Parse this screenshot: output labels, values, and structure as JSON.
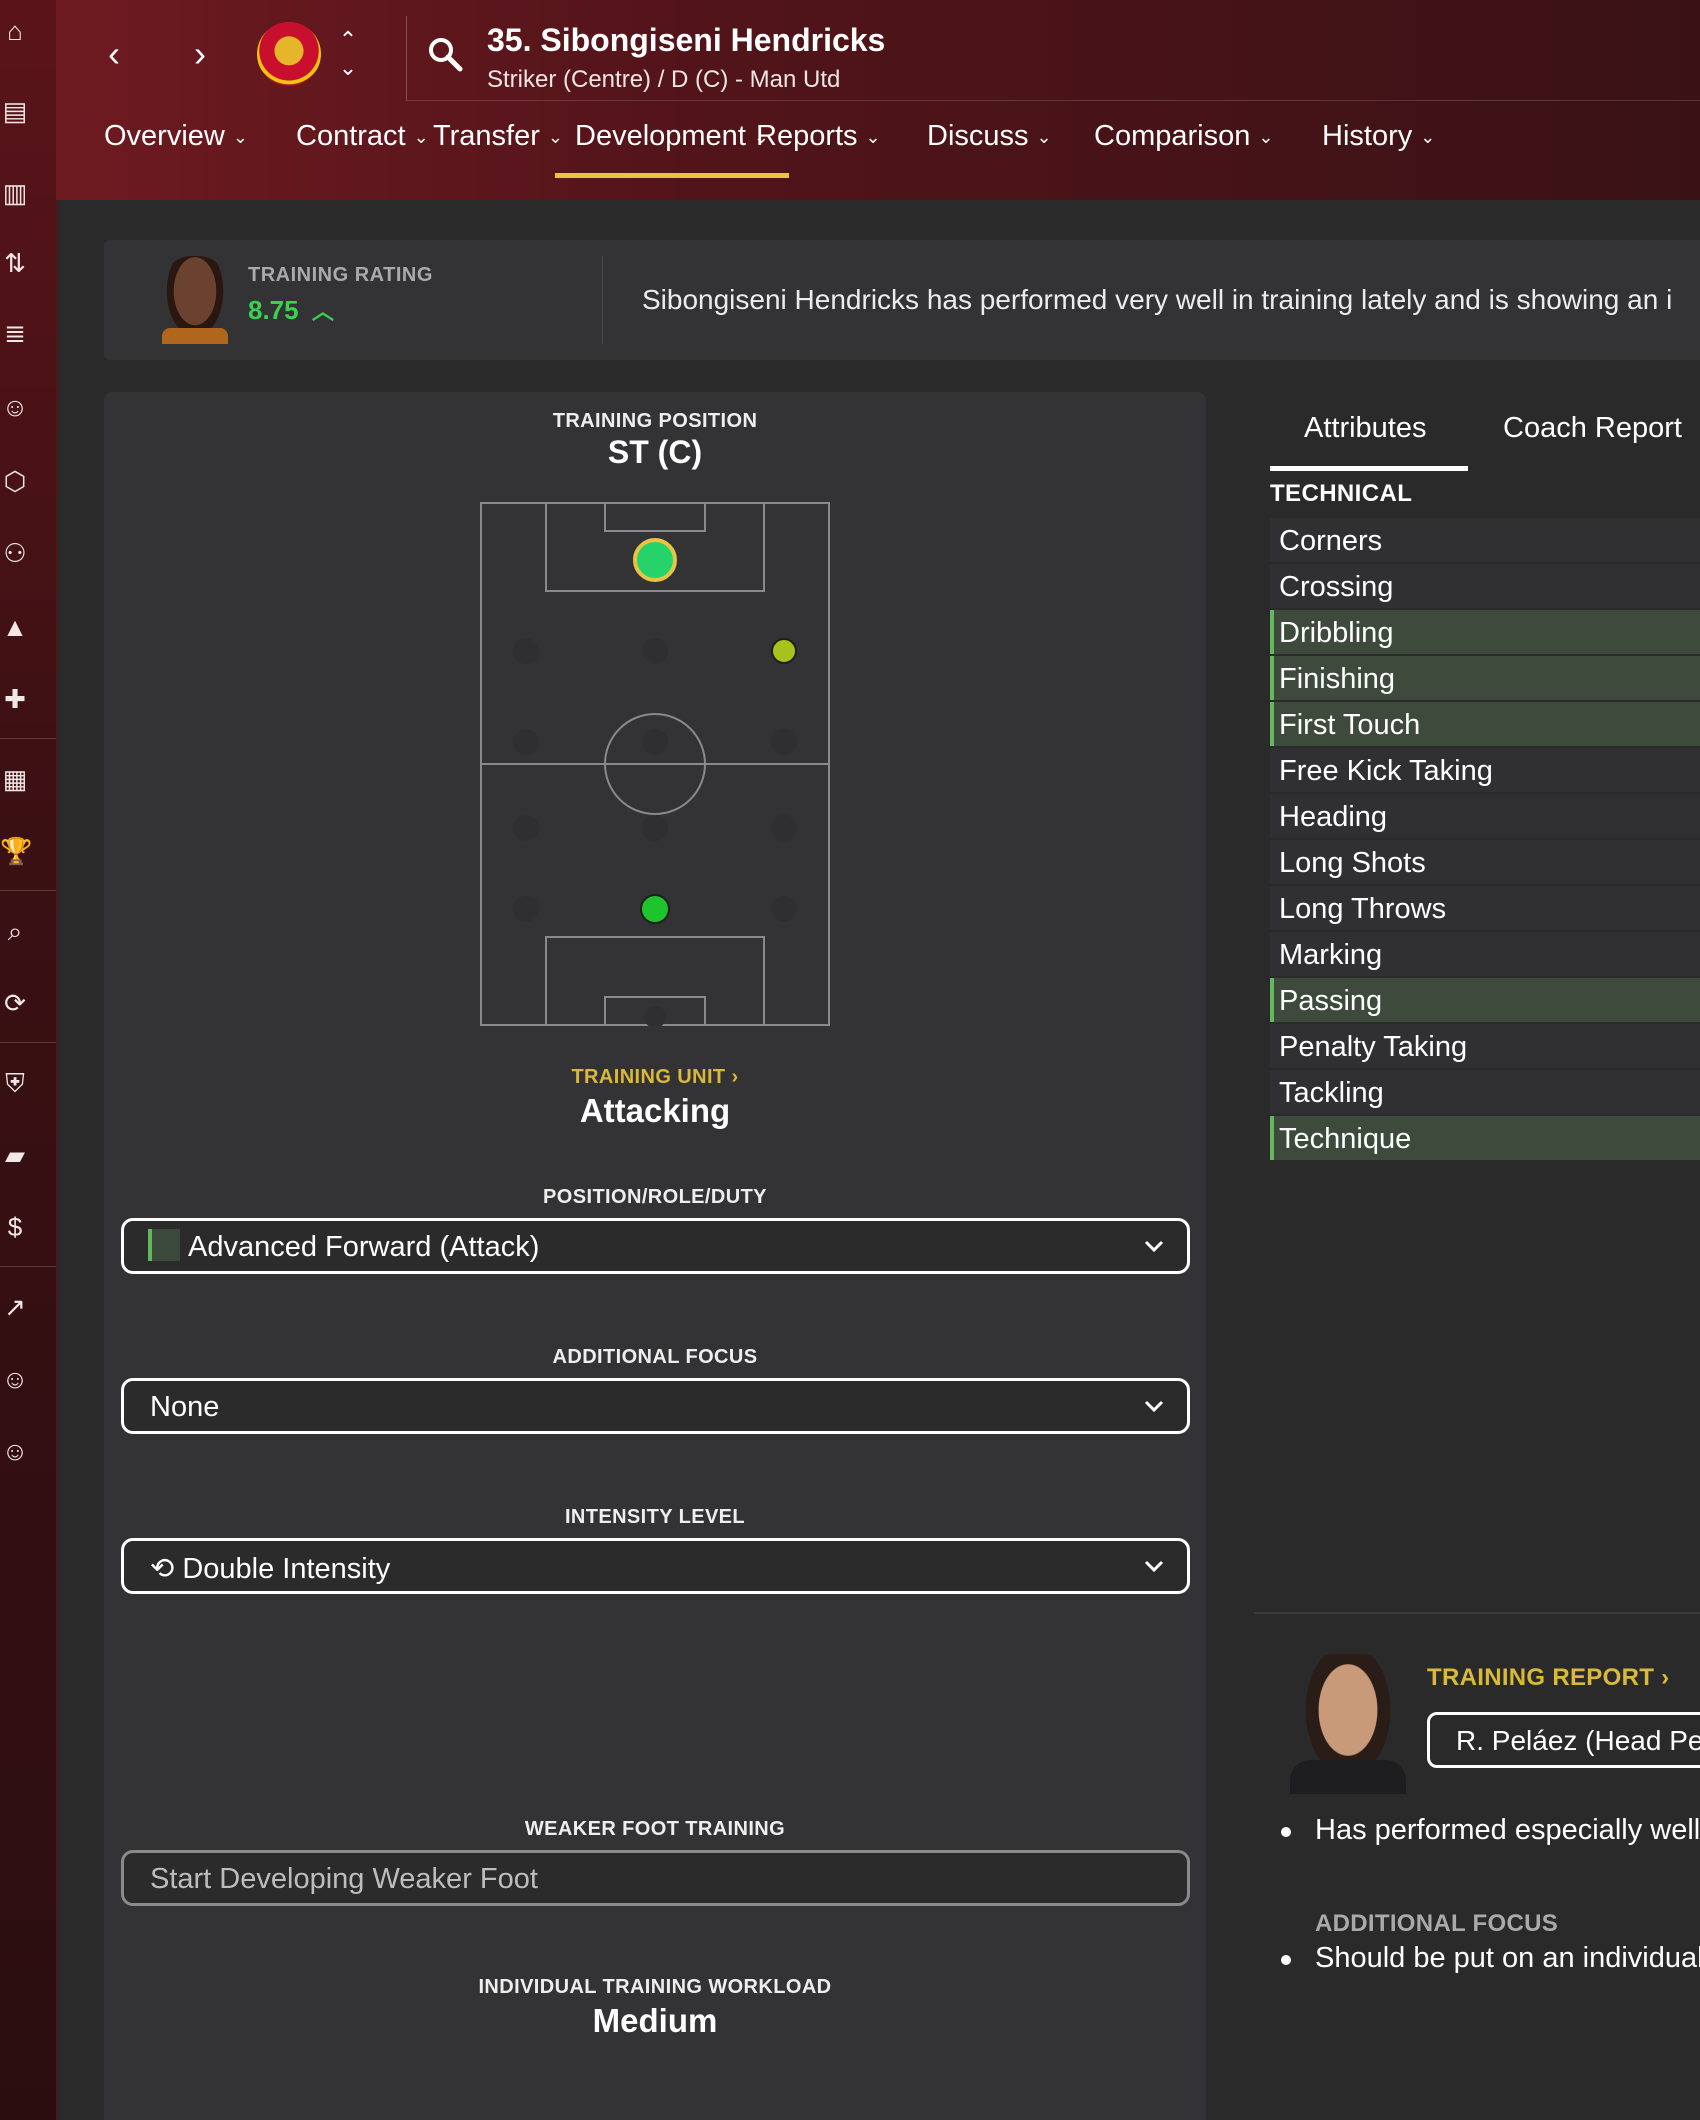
{
  "header": {
    "player_name": "35. Sibongiseni Hendricks",
    "player_sub": "Striker (Centre) / D (C) - Man Utd"
  },
  "tabs": [
    {
      "label": "Overview"
    },
    {
      "label": "Contract"
    },
    {
      "label": "Transfer"
    },
    {
      "label": "Development"
    },
    {
      "label": "Reports"
    },
    {
      "label": "Discuss"
    },
    {
      "label": "Comparison"
    },
    {
      "label": "History"
    }
  ],
  "active_tab": "Development",
  "training_rating": {
    "label": "TRAINING RATING",
    "value": "8.75",
    "trend": "up",
    "summary": "Sibongiseni Hendricks has performed very well in training lately and is showing an i"
  },
  "training_position": {
    "label": "TRAINING POSITION",
    "value": "ST (C)"
  },
  "training_unit": {
    "label": "TRAINING UNIT",
    "value": "Attacking"
  },
  "position_role_duty": {
    "label": "POSITION/ROLE/DUTY",
    "value": "Advanced Forward (Attack)"
  },
  "additional_focus": {
    "label": "ADDITIONAL FOCUS",
    "value": "None"
  },
  "intensity_level": {
    "label": "INTENSITY LEVEL",
    "value": "Double Intensity"
  },
  "weaker_foot": {
    "label": "WEAKER FOOT TRAINING",
    "value": "Start Developing Weaker Foot"
  },
  "workload": {
    "label": "INDIVIDUAL TRAINING WORKLOAD",
    "value": "Medium"
  },
  "right_tabs": [
    {
      "label": "Attributes"
    },
    {
      "label": "Coach Report"
    }
  ],
  "technical": {
    "heading": "TECHNICAL",
    "attributes": [
      {
        "label": "Corners",
        "highlight": false
      },
      {
        "label": "Crossing",
        "highlight": false
      },
      {
        "label": "Dribbling",
        "highlight": true
      },
      {
        "label": "Finishing",
        "highlight": true
      },
      {
        "label": "First Touch",
        "highlight": true
      },
      {
        "label": "Free Kick Taking",
        "highlight": false
      },
      {
        "label": "Heading",
        "highlight": false
      },
      {
        "label": "Long Shots",
        "highlight": false
      },
      {
        "label": "Long Throws",
        "highlight": false
      },
      {
        "label": "Marking",
        "highlight": false
      },
      {
        "label": "Passing",
        "highlight": true
      },
      {
        "label": "Penalty Taking",
        "highlight": false
      },
      {
        "label": "Tackling",
        "highlight": false
      },
      {
        "label": "Technique",
        "highlight": true
      }
    ]
  },
  "coach": {
    "report_label": "TRAINING REPORT",
    "coach_name": "R. Peláez (Head Per",
    "bullet_1": "Has performed especially well",
    "focus_label": "ADDITIONAL FOCUS",
    "bullet_2": "Should be put on an individual"
  },
  "colors": {
    "accent_gold": "#e8c444",
    "rating_green": "#39d24e",
    "highlight_row": "#3d4a3c",
    "highlight_bar": "#62b85a"
  }
}
